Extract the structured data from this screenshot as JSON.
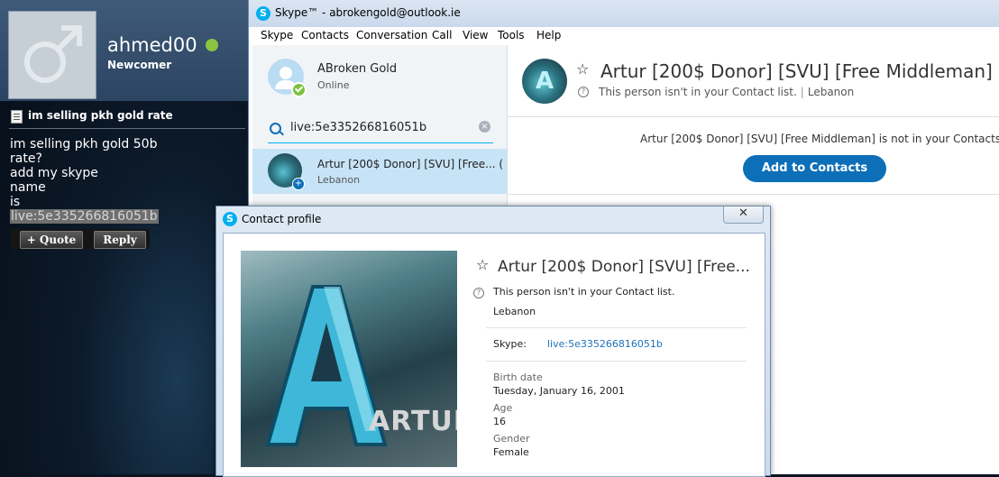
{
  "forum": {
    "username": "ahmed00",
    "rank": "Newcomer",
    "post_title": "im selling pkh gold rate",
    "post_lines": [
      "im selling pkh gold 50b",
      "rate?",
      "add my skype",
      "name",
      "is"
    ],
    "post_highlight": "live:5e335266816051b",
    "quote_label": "+ Quote",
    "separator": "|",
    "reply_label": "Reply",
    "online_color": "#8bc43f"
  },
  "skype": {
    "window_title": "Skype™ - abrokengold@outlook.ie",
    "logo_glyph": "S",
    "menu": [
      "Skype",
      "Contacts",
      "Conversation",
      "Call",
      "View",
      "Tools",
      "Help"
    ],
    "self": {
      "name": "ABroken Gold",
      "status": "Online"
    },
    "search": {
      "value": "live:5e335266816051b",
      "clear_glyph": "×"
    },
    "search_result": {
      "name": "Artur [200$ Donor] [SVU] [Free... (",
      "location": "Lebanon",
      "add_glyph": "+"
    },
    "contact": {
      "avatar_letter": "A",
      "star_glyph": "☆",
      "name": "Artur [200$ Donor] [SVU] [Free Middleman]",
      "info_glyph": "?",
      "note": "This person isn't in your Contact list.",
      "sub_separator": "|",
      "location": "Lebanon",
      "not_in_contacts": "Artur [200$ Donor] [SVU] [Free Middleman] is not in your Contacts",
      "add_button": "Add to Contacts"
    },
    "accent_color": "#0d6fb8"
  },
  "profile_dialog": {
    "title": "Contact profile",
    "close_glyph": "✕",
    "photo_text": "ARTUR",
    "star_glyph": "☆",
    "name": "Artur [200$ Donor] [SVU] [Free...",
    "info_glyph": "?",
    "note": "This person isn't in your Contact list.",
    "location": "Lebanon",
    "skype_label": "Skype:",
    "skype_value": "live:5e335266816051b",
    "birth_label": "Birth date",
    "birth_value": "Tuesday, January 16, 2001",
    "age_label": "Age",
    "age_value": "16",
    "gender_label": "Gender",
    "gender_value": "Female"
  }
}
